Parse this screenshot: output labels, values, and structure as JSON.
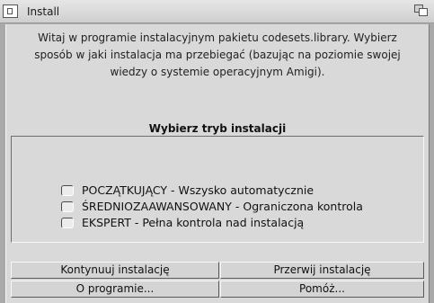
{
  "window": {
    "title": "Install"
  },
  "intro": {
    "lines": [
      "Witaj w programie instalacyjnym pakietu codesets.library. Wybierz",
      "sposób w jaki instalacja ma przebiegać (bazując na poziomie swojej",
      "wiedzy o systemie operacyjnym Amigi)."
    ]
  },
  "mode_section": {
    "title": "Wybierz tryb instalacji",
    "options": [
      {
        "label": "POCZĄTKUJĄCY - Wszysko automatycznie"
      },
      {
        "label": "ŚREDNIOZAAWANSOWANY - Ograniczona kontrola"
      },
      {
        "label": "EKSPERT - Pełna kontrola nad instalacją"
      }
    ]
  },
  "buttons": {
    "proceed": "Kontynuuj instalację",
    "abort": "Przerwij instalację",
    "about": "O programie...",
    "help": "Pomóż..."
  }
}
